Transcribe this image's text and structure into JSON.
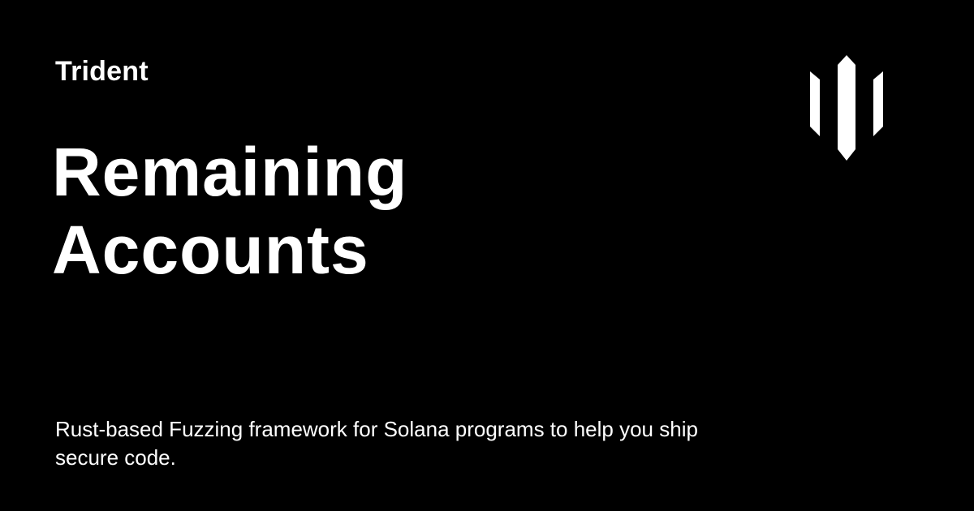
{
  "brand": {
    "name": "Trident",
    "logo_icon": "trident-logo-icon",
    "logo_color": "#ffffff"
  },
  "page": {
    "title_line1": "Remaining",
    "title_line2": "Accounts",
    "description": "Rust-based Fuzzing framework for Solana programs to help you ship secure code."
  },
  "colors": {
    "background": "#000000",
    "text": "#ffffff"
  }
}
